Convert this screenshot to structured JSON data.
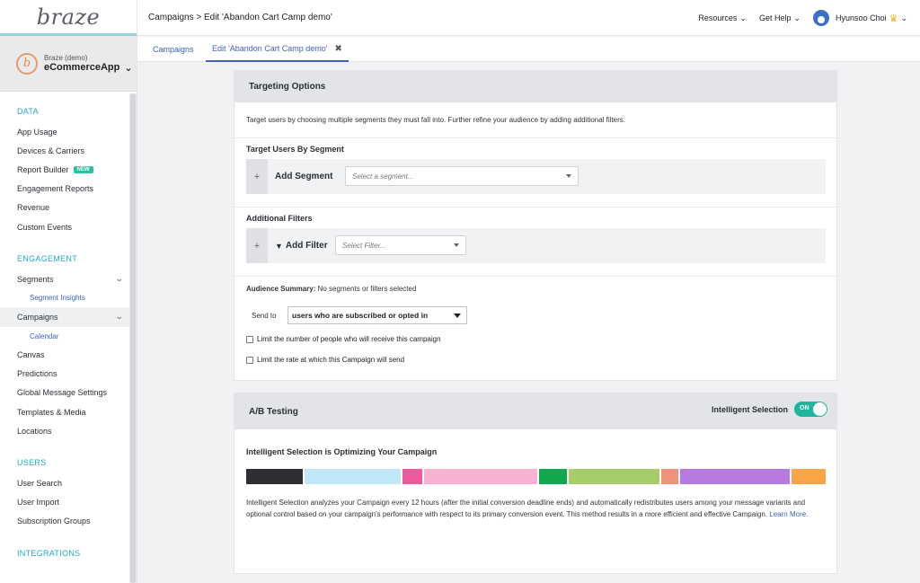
{
  "brand": {
    "logo": "braze"
  },
  "app_switcher": {
    "org": "Braze (demo)",
    "app": "eCommerceApp"
  },
  "breadcrumb": "Campaigns > Edit 'Abandon Cart Camp demo'",
  "topbar": {
    "resources": "Resources",
    "help": "Get Help",
    "user": "Hyunsoo Choi"
  },
  "tabs": [
    {
      "label": "Campaigns"
    },
    {
      "label": "Edit 'Abandon Cart Camp demo'",
      "close": "✖"
    }
  ],
  "nav": {
    "data_section": "DATA",
    "data_items": [
      "App Usage",
      "Devices & Carriers",
      "Report Builder",
      "Engagement Reports",
      "Revenue",
      "Custom Events"
    ],
    "new_badge": "NEW",
    "engagement_section": "ENGAGEMENT",
    "segments": "Segments",
    "segment_insights": "Segment Insights",
    "campaigns": "Campaigns",
    "calendar": "Calendar",
    "engagement_items": [
      "Canvas",
      "Predictions",
      "Global Message Settings",
      "Templates & Media",
      "Locations"
    ],
    "users_section": "USERS",
    "users_items": [
      "User Search",
      "User Import",
      "Subscription Groups"
    ],
    "integrations_section": "INTEGRATIONS"
  },
  "targeting": {
    "title": "Targeting Options",
    "intro": "Target users by choosing multiple segments they must fall into. Further refine your audience by adding additional filters.",
    "segment_heading": "Target Users By Segment",
    "add_segment": "Add Segment",
    "segment_placeholder": "Select a segment...",
    "filters_heading": "Additional Filters",
    "add_filter": "Add Filter",
    "filter_placeholder": "Select Filter...",
    "summary_label": "Audience Summary:",
    "summary_value": "No segments or filters selected",
    "send_to_label": "Send to",
    "send_to_value": "users who are subscribed or opted in",
    "limit_people": "Limit the number of people who will receive this campaign",
    "limit_rate": "Limit the rate at which this Campaign will send"
  },
  "ab": {
    "title": "A/B Testing",
    "intelligent_label": "Intelligent Selection",
    "toggle_text": "ON",
    "optimizing_heading": "Intelligent Selection is Optimizing Your Campaign",
    "variants": [
      {
        "share": 10,
        "color": "#2d2f33"
      },
      {
        "share": 17,
        "color": "#bfe7f7"
      },
      {
        "share": 3.5,
        "color": "#ee5a9b"
      },
      {
        "share": 20,
        "color": "#f7b1d1"
      },
      {
        "share": 5,
        "color": "#10a94f"
      },
      {
        "share": 16,
        "color": "#a6cd6a"
      },
      {
        "share": 3,
        "color": "#f1927b"
      },
      {
        "share": 19.5,
        "color": "#b67ae0"
      },
      {
        "share": 6,
        "color": "#f8a547"
      }
    ],
    "description": "Intelligent Selection analyzes your Campaign every 12 hours (after the initial conversion deadline ends) and automatically redistributes users among your message variants and optional control based on your campaign's performance with respect to its primary conversion event. This method results in a more efficient and effective Campaign.",
    "learn_more": "Learn More."
  }
}
